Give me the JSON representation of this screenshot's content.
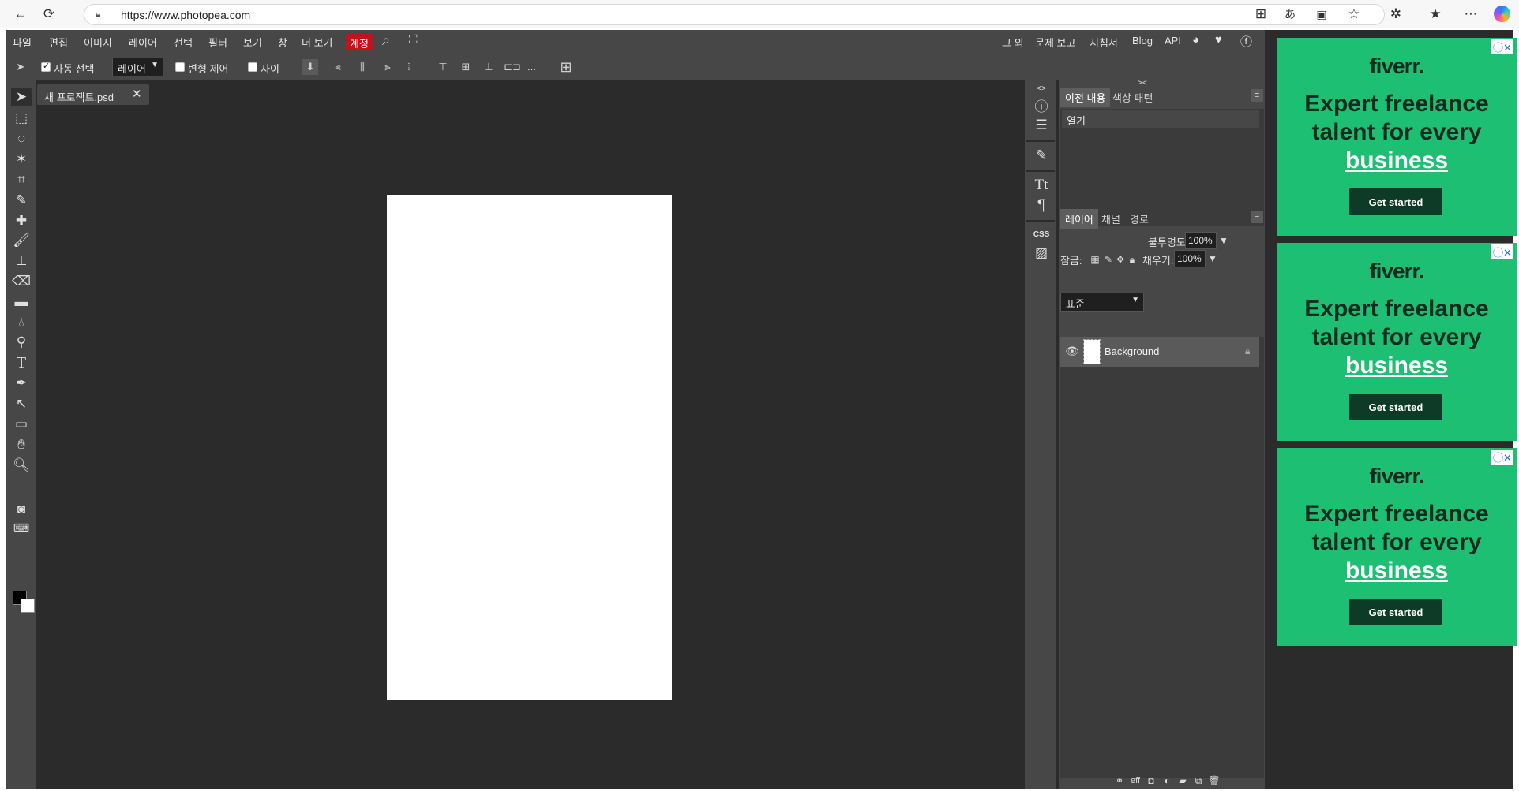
{
  "browser": {
    "url": "https://www.photopea.com",
    "icons": [
      "back-icon",
      "refresh-icon",
      "lock-icon",
      "apps-icon",
      "translate-icon",
      "immersive-reader-icon",
      "star-icon",
      "extensions-icon",
      "favorites-icon",
      "more-icon",
      "copilot-icon"
    ]
  },
  "menu": {
    "items": [
      "파일",
      "편집",
      "이미지",
      "레이어",
      "선택",
      "필터",
      "보기",
      "창",
      "더 보기"
    ],
    "account": "계정",
    "right_items": [
      "그 외",
      "문제 보고",
      "지침서",
      "Blog",
      "API"
    ],
    "social": [
      "reddit-icon",
      "twitter-icon",
      "facebook-icon"
    ]
  },
  "options": {
    "auto_select_label": "자동 선택",
    "auto_select_checked": true,
    "layer_select_value": "레이어",
    "transform_label": "변형 제어",
    "transform_checked": false,
    "distance_label": "자이",
    "distance_checked": false,
    "more": "..."
  },
  "document": {
    "tab_name": "새 프로젝트.psd",
    "close_glyph": "✕"
  },
  "panels": {
    "history_tabs": [
      "이전 내용",
      "색상 패턴"
    ],
    "history_items": [
      "열기"
    ],
    "layers_tabs": [
      "레이어",
      "채널",
      "경로"
    ],
    "blend_mode": "표준",
    "opacity_label": "불투명도:",
    "opacity_value": "100%",
    "lock_label": "잠금:",
    "fill_label": "채우기:",
    "fill_value": "100%",
    "layers": [
      {
        "name": "Background",
        "visible": true,
        "locked": true
      }
    ],
    "footer_labels": [
      "eff"
    ]
  },
  "ads": [
    {
      "logo": "fiverr.",
      "line1": "Expert freelance",
      "line2": "talent for every",
      "link": "business",
      "button": "Get started"
    },
    {
      "logo": "fiverr.",
      "line1": "Expert freelance",
      "line2": "talent for every",
      "link": "business",
      "button": "Get started"
    },
    {
      "logo": "fiverr.",
      "line1": "Expert freelance",
      "line2": "talent for every",
      "link": "business",
      "button": "Get started"
    }
  ],
  "colors": {
    "accent_account": "#c7101b",
    "ad_green": "#1dbf73",
    "workspace": "#2b2b2b",
    "panel": "#474747"
  }
}
